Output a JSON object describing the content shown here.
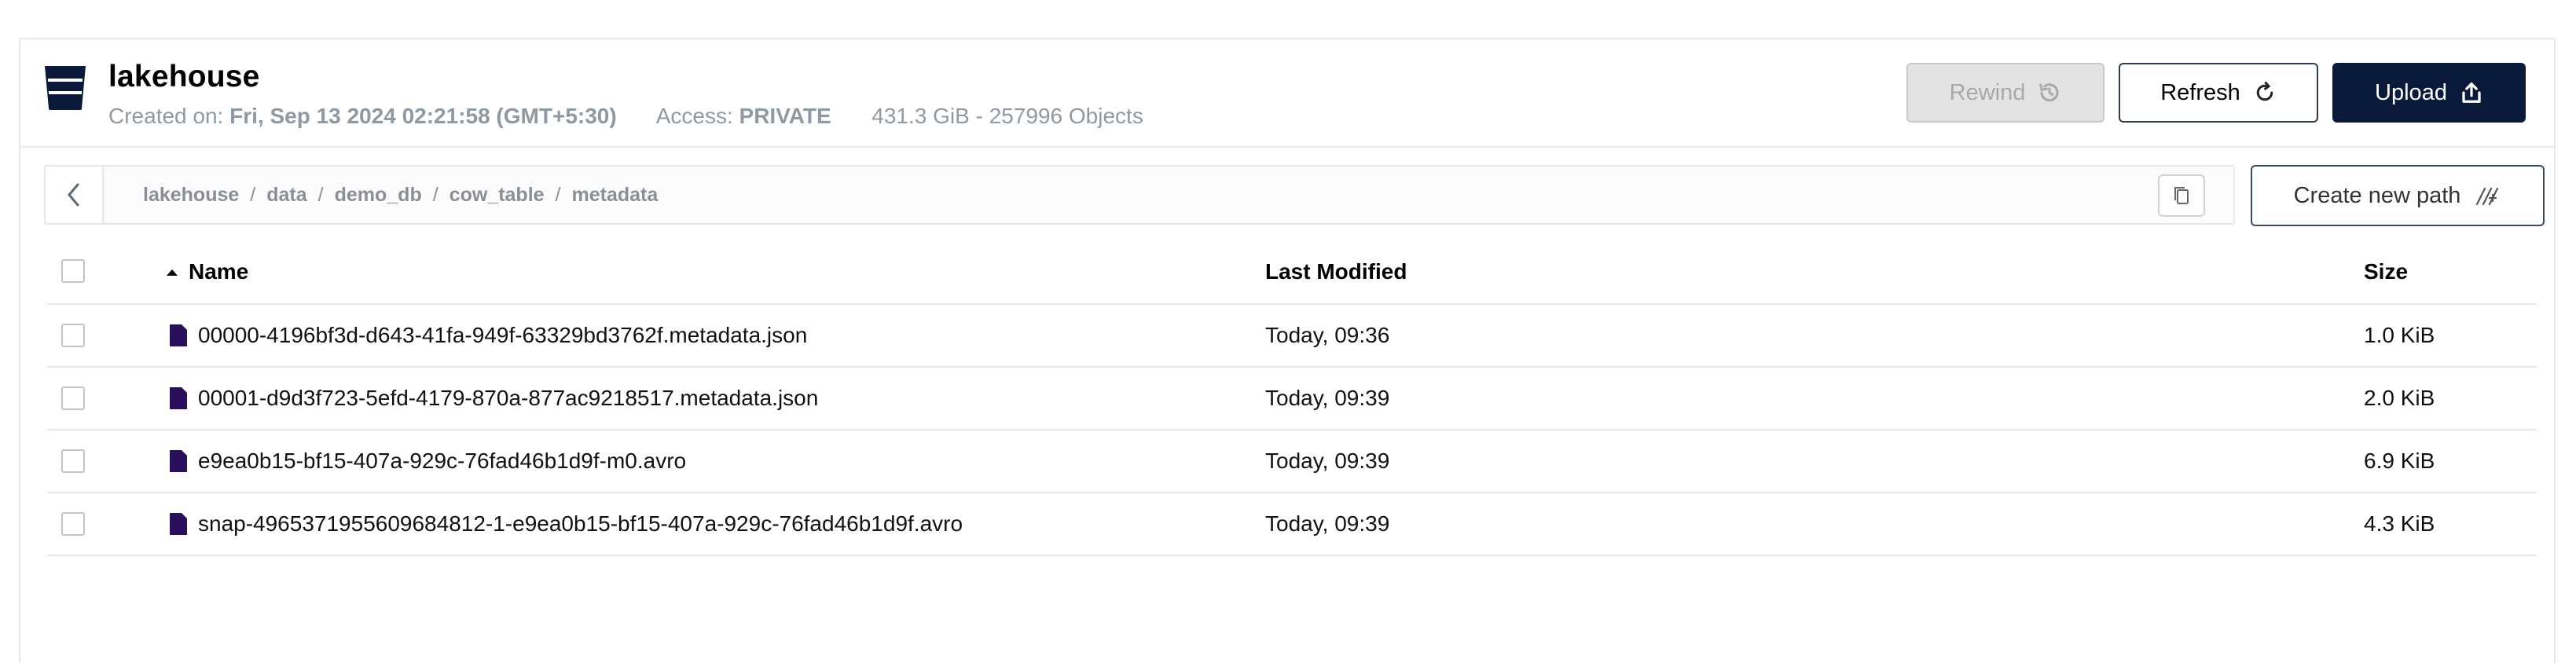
{
  "bucket": {
    "name": "lakehouse",
    "created_label": "Created on:",
    "created_value": "Fri, Sep 13 2024 02:21:58 (GMT+5:30)",
    "access_label": "Access:",
    "access_value": "PRIVATE",
    "usage": "431.3 GiB - 257996 Objects"
  },
  "toolbar": {
    "rewind_label": "Rewind",
    "refresh_label": "Refresh",
    "upload_label": "Upload"
  },
  "breadcrumb": {
    "parts": [
      "lakehouse",
      "data",
      "demo_db",
      "cow_table",
      "metadata"
    ]
  },
  "create_path_label": "Create new path",
  "table": {
    "columns": {
      "name": "Name",
      "modified": "Last Modified",
      "size": "Size"
    },
    "rows": [
      {
        "name": "00000-4196bf3d-d643-41fa-949f-63329bd3762f.metadata.json",
        "modified": "Today, 09:36",
        "size": "1.0 KiB"
      },
      {
        "name": "00001-d9d3f723-5efd-4179-870a-877ac9218517.metadata.json",
        "modified": "Today, 09:39",
        "size": "2.0 KiB"
      },
      {
        "name": "e9ea0b15-bf15-407a-929c-76fad46b1d9f-m0.avro",
        "modified": "Today, 09:39",
        "size": "6.9 KiB"
      },
      {
        "name": "snap-4965371955609684812-1-e9ea0b15-bf15-407a-929c-76fad46b1d9f.avro",
        "modified": "Today, 09:39",
        "size": "4.3 KiB"
      }
    ]
  },
  "colors": {
    "primary": "#0a1a3a",
    "file_icon": "#2a0f5c",
    "muted_text": "#8e99a4"
  },
  "icons": {
    "bucket": "bucket-icon",
    "rewind": "history-icon",
    "refresh": "refresh-icon",
    "upload": "upload-icon",
    "back": "chevron-left-icon",
    "copy": "copy-icon",
    "create_path": "new-path-icon",
    "sort": "sort-asc-icon",
    "file": "file-icon"
  }
}
